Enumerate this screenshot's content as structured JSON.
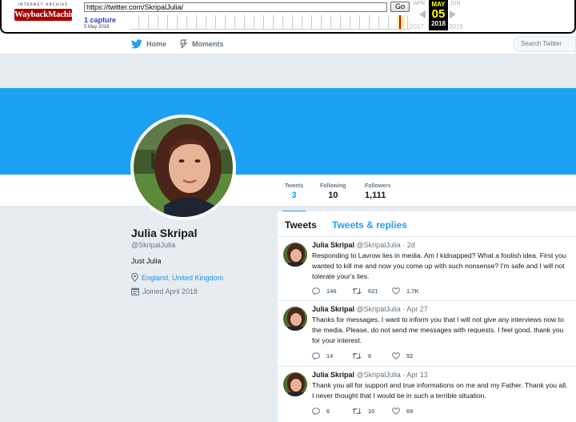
{
  "wayback": {
    "logo_top": "INTERNET ARCHIVE",
    "logo_main": "WaybackMachine",
    "url": "https://twitter.com/SkripalJulia/",
    "go_label": "Go",
    "captures": "1 capture",
    "capture_date": "5 May 2018",
    "prev_month": "APR",
    "cur_month": "MAY",
    "next_month": "JUN",
    "cur_day": "05",
    "prev_year": "2017",
    "cur_year": "2018",
    "next_year": "2019"
  },
  "nav": {
    "home": "Home",
    "moments": "Moments",
    "search_placeholder": "Search Twitter"
  },
  "stats": [
    {
      "label": "Tweets",
      "value": "3"
    },
    {
      "label": "Following",
      "value": "10"
    },
    {
      "label": "Followers",
      "value": "1,111"
    }
  ],
  "profile": {
    "name": "Julia Skripal",
    "handle": "@SkripalJulia",
    "bio": "Just Julia",
    "location": "England, United Kingdom",
    "joined": "Joined April 2018"
  },
  "tabs": {
    "tweets": "Tweets",
    "replies": "Tweets & replies"
  },
  "tweets": [
    {
      "name": "Julia Skripal",
      "handle": "@SkripalJulia · 2d",
      "text": "Responding to Lavrow lies in media. Am I kidnapped? What a foolish idea. First you wanted to kill me and now you come up with such nonsense? I'm safe and I will not tolerate your's lies.",
      "replies": "146",
      "retweets": "621",
      "likes": "1.7K"
    },
    {
      "name": "Julia Skripal",
      "handle": "@SkripalJulia · Apr 27",
      "text": "Thanks for messages. I want to inform you that I will not give any interviews now to the media. Please, do not send me messages with requests. I feel good, thank you for your interest.",
      "replies": "14",
      "retweets": "6",
      "likes": "52"
    },
    {
      "name": "Julia Skripal",
      "handle": "@SkripalJulia · Apr 13",
      "text": "Thank you all for support and true informations on me and my Father.  Thank you all. I never thought that I would be in such a terrible situation.",
      "replies": "6",
      "retweets": "10",
      "likes": "69"
    }
  ],
  "colors": {
    "brand": "#1da1f2",
    "link": "#1b95e0",
    "background": "#e6ecf0"
  }
}
